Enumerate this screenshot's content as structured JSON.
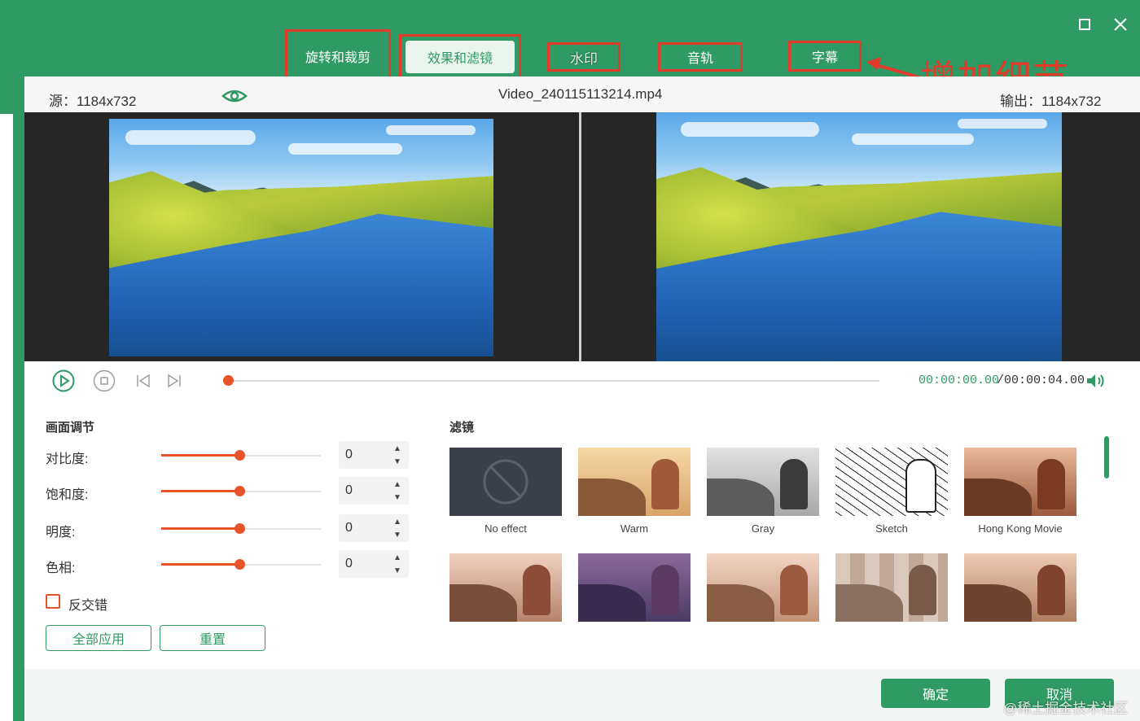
{
  "tabs": {
    "rotate_crop": "旋转和裁剪",
    "effects_filters": "效果和滤镜",
    "watermark": "水印",
    "audio_track": "音轨",
    "subtitle": "字幕"
  },
  "annotation": {
    "text": "增加细节"
  },
  "info": {
    "source": "源：1184x732",
    "file_name": "Video_240115113214.mp4",
    "output": "输出：1184x732"
  },
  "player": {
    "time_current": "00:00:00.00",
    "time_total": "/00:00:04.00",
    "progress": 0
  },
  "adjust": {
    "title": "画面调节",
    "rows": [
      {
        "label": "对比度:",
        "value": "0"
      },
      {
        "label": "饱和度:",
        "value": "0"
      },
      {
        "label": "明度:",
        "value": "0"
      },
      {
        "label": "色相:",
        "value": "0"
      }
    ],
    "deinterlace_label": "反交错",
    "apply_all": "全部应用",
    "reset": "重置"
  },
  "filters": {
    "title": "滤镜",
    "items": [
      {
        "name": "No effect"
      },
      {
        "name": "Warm"
      },
      {
        "name": "Gray"
      },
      {
        "name": "Sketch"
      },
      {
        "name": "Hong Kong Movie"
      },
      {
        "name": ""
      },
      {
        "name": ""
      },
      {
        "name": ""
      },
      {
        "name": ""
      },
      {
        "name": ""
      }
    ]
  },
  "footer": {
    "ok": "确定",
    "cancel": "取消"
  },
  "watermark_text": "@稀土掘金技术社区",
  "colors": {
    "brand": "#2f9a63",
    "accent": "#e8532a",
    "highlight": "#e53a2a"
  }
}
